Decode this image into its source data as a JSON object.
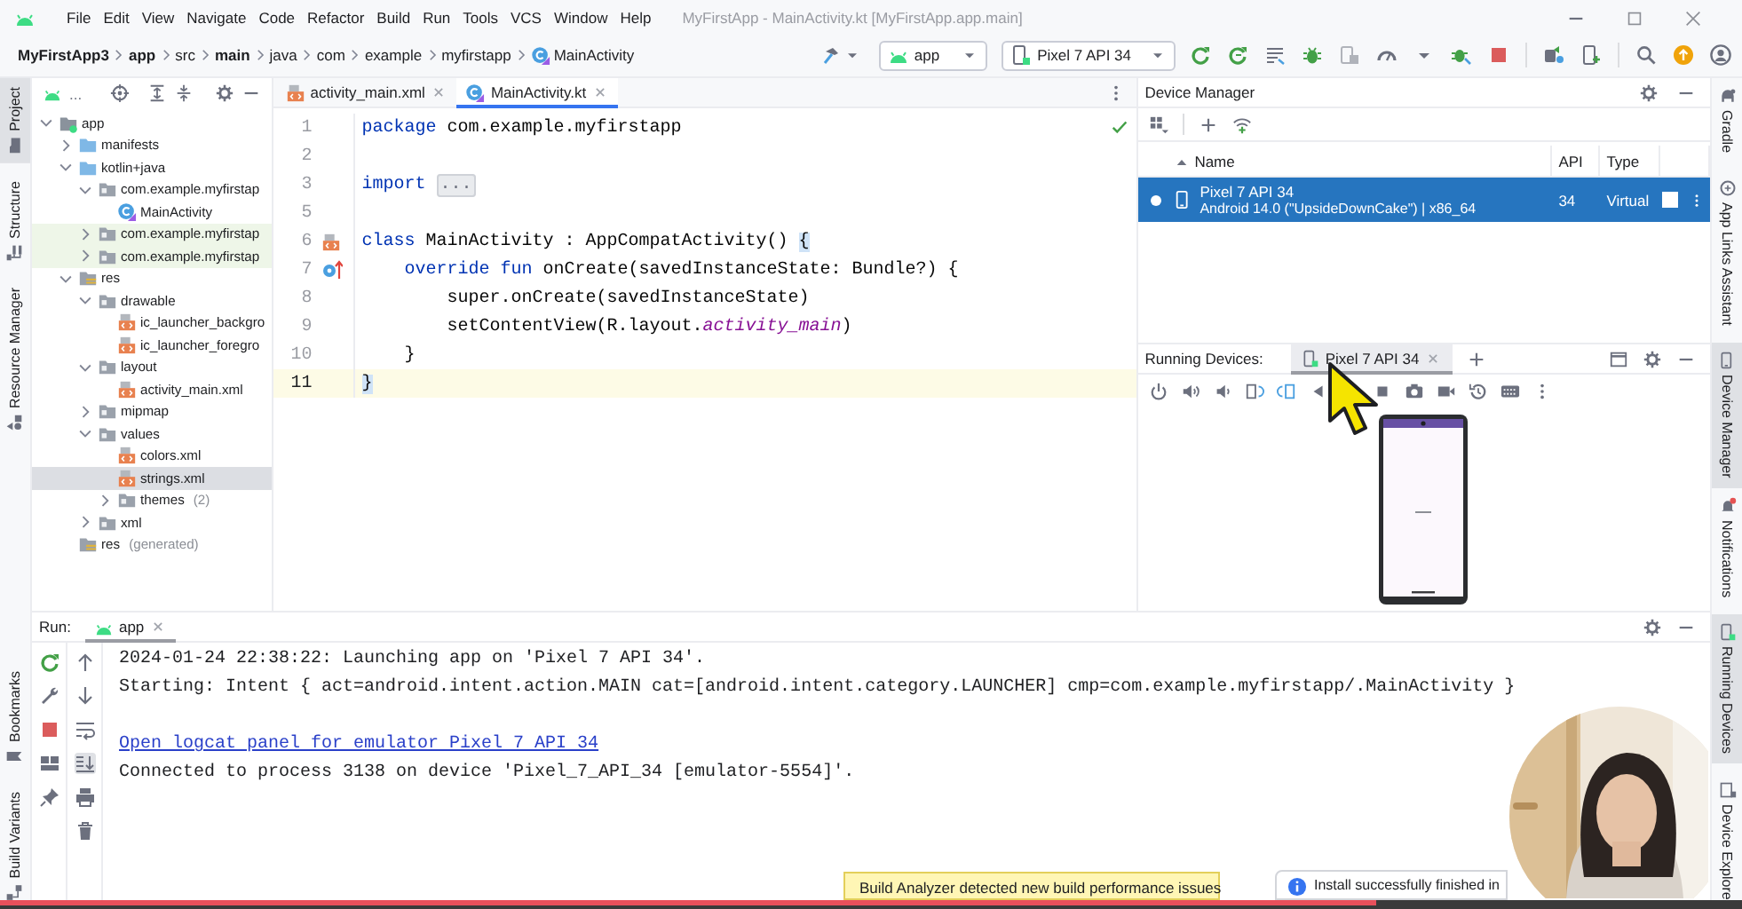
{
  "window": {
    "title": "MyFirstApp - MainActivity.kt [MyFirstApp.app.main]"
  },
  "menu": [
    "File",
    "Edit",
    "View",
    "Navigate",
    "Code",
    "Refactor",
    "Build",
    "Run",
    "Tools",
    "VCS",
    "Window",
    "Help"
  ],
  "breadcrumb": [
    {
      "label": "MyFirstApp3",
      "bold": true,
      "kind": "path"
    },
    {
      "label": "app",
      "bold": true,
      "kind": "path"
    },
    {
      "label": "src",
      "bold": false,
      "kind": "path"
    },
    {
      "label": "main",
      "bold": true,
      "kind": "path"
    },
    {
      "label": "java",
      "bold": false,
      "kind": "path"
    },
    {
      "label": "com",
      "bold": false,
      "kind": "path"
    },
    {
      "label": "example",
      "bold": false,
      "kind": "path"
    },
    {
      "label": "myfirstapp",
      "bold": false,
      "kind": "path"
    },
    {
      "label": "MainActivity",
      "bold": false,
      "kind": "class"
    }
  ],
  "toolbar": {
    "run_config": "app",
    "device": "Pixel 7 API 34"
  },
  "left_stripe": {
    "top": [
      {
        "label": "Project",
        "kind": "project",
        "selected": true
      },
      {
        "label": "Structure",
        "kind": "structure",
        "selected": false
      },
      {
        "label": "Resource Manager",
        "kind": "resources",
        "selected": false
      }
    ],
    "bottom": [
      {
        "label": "Bookmarks",
        "kind": "bookmarks",
        "selected": false
      },
      {
        "label": "Build Variants",
        "kind": "variants",
        "selected": false
      }
    ]
  },
  "right_stripe": {
    "top": [
      {
        "label": "Gradle",
        "kind": "gradle",
        "selected": false
      },
      {
        "label": "App Links Assistant",
        "kind": "links",
        "selected": false
      },
      {
        "label": "Device Manager",
        "kind": "devices",
        "selected": true
      }
    ],
    "bottom": [
      {
        "label": "Notifications",
        "kind": "notifications",
        "selected": false
      },
      {
        "label": "Running Devices",
        "kind": "running",
        "selected": true
      },
      {
        "label": "Device Explore",
        "kind": "explorer",
        "selected": false
      }
    ]
  },
  "project": {
    "view_label": "...",
    "tree": [
      {
        "label": "app",
        "kind": "module",
        "expanded": true,
        "selected": false,
        "children": [
          {
            "label": "manifests",
            "kind": "source-folder",
            "expanded": false,
            "selected": false
          },
          {
            "label": "kotlin+java",
            "kind": "source-folder",
            "expanded": true,
            "selected": false,
            "children": [
              {
                "label": "com.example.myfirstap",
                "kind": "package",
                "expanded": true,
                "selected": false,
                "children": [
                  {
                    "label": "MainActivity",
                    "kind": "class",
                    "selected": false
                  }
                ]
              },
              {
                "label": "com.example.myfirstap",
                "kind": "test-package",
                "expanded": false,
                "selected": false
              },
              {
                "label": "com.example.myfirstap",
                "kind": "test-package",
                "expanded": false,
                "selected": false
              }
            ]
          },
          {
            "label": "res",
            "kind": "res-folder",
            "expanded": true,
            "selected": false,
            "children": [
              {
                "label": "drawable",
                "kind": "package",
                "expanded": true,
                "selected": false,
                "children": [
                  {
                    "label": "ic_launcher_backgro",
                    "kind": "xml",
                    "selected": false
                  },
                  {
                    "label": "ic_launcher_foregro",
                    "kind": "xml",
                    "selected": false
                  }
                ]
              },
              {
                "label": "layout",
                "kind": "package",
                "expanded": true,
                "selected": false,
                "children": [
                  {
                    "label": "activity_main.xml",
                    "kind": "xml",
                    "selected": false
                  }
                ]
              },
              {
                "label": "mipmap",
                "kind": "package",
                "expanded": false,
                "selected": false
              },
              {
                "label": "values",
                "kind": "package",
                "expanded": true,
                "selected": false,
                "children": [
                  {
                    "label": "colors.xml",
                    "kind": "xml",
                    "selected": false
                  },
                  {
                    "label": "strings.xml",
                    "kind": "xml",
                    "selected": true
                  },
                  {
                    "label": "themes",
                    "count": "(2)",
                    "kind": "package",
                    "expanded": false,
                    "selected": false
                  }
                ]
              },
              {
                "label": "xml",
                "kind": "package",
                "expanded": false,
                "selected": false
              }
            ]
          },
          {
            "label": "res",
            "count": "(generated)",
            "kind": "res-folder",
            "selected": false
          }
        ]
      }
    ]
  },
  "editor": {
    "tabs": [
      {
        "label": "activity_main.xml",
        "kind": "xml",
        "selected": false
      },
      {
        "label": "MainActivity.kt",
        "kind": "class",
        "selected": true
      }
    ],
    "lines": [
      {
        "number": "1",
        "current": false,
        "tokens": [
          {
            "kind": "keyword",
            "text": "package"
          },
          {
            "kind": "plain",
            "text": " com.example.myfirstapp"
          }
        ]
      },
      {
        "number": "2",
        "current": false
      },
      {
        "number": "3",
        "current": false,
        "tokens": [
          {
            "kind": "keyword",
            "text": "import"
          },
          {
            "kind": "fold",
            "text": "..."
          }
        ]
      },
      {
        "number": "5",
        "current": false
      },
      {
        "number": "6",
        "current": false,
        "marker": {
          "kind": "layout"
        },
        "tokens": [
          {
            "kind": "keyword",
            "text": "class"
          },
          {
            "kind": "plain",
            "text": " MainActivity : AppCompatActivity() "
          },
          {
            "kind": "brace",
            "text": "{"
          }
        ]
      },
      {
        "number": "7",
        "current": false,
        "marker": {
          "kind": "override"
        },
        "tokens": [
          {
            "kind": "keyword",
            "text": "    override fun"
          },
          {
            "kind": "plain",
            "text": " onCreate(savedInstanceState: Bundle?) {"
          }
        ]
      },
      {
        "number": "8",
        "current": false,
        "tokens": [
          {
            "kind": "plain",
            "text": "        super.onCreate(savedInstanceState)"
          }
        ]
      },
      {
        "number": "9",
        "current": false,
        "tokens": [
          {
            "kind": "plain",
            "text": "        setContentView(R.layout."
          },
          {
            "kind": "ref",
            "text": "activity_main"
          },
          {
            "kind": "plain",
            "text": ")"
          }
        ]
      },
      {
        "number": "10",
        "current": false,
        "tokens": [
          {
            "kind": "plain",
            "text": "    }"
          }
        ]
      },
      {
        "number": "11",
        "current": true,
        "tokens": [
          {
            "kind": "brace",
            "text": "}"
          }
        ]
      }
    ]
  },
  "device_manager": {
    "title": "Device Manager",
    "columns": [
      "Name",
      "API",
      "Type"
    ],
    "devices": [
      {
        "name": "Pixel 7 API 34",
        "details": "Android 14.0 (\"UpsideDownCake\") | x86_64",
        "api": "34",
        "type": "Virtual",
        "selected": true,
        "online": true
      }
    ]
  },
  "running_devices": {
    "label": "Running Devices:",
    "tabs": [
      {
        "label": "Pixel 7 API 34",
        "selected": true
      }
    ]
  },
  "run_panel": {
    "label": "Run:",
    "tabs": [
      {
        "label": "app",
        "selected": true
      }
    ],
    "lines": [
      {
        "kind": "text",
        "text": "2024-01-24 22:38:22: Launching app on 'Pixel 7 API 34'."
      },
      {
        "kind": "text",
        "text": "Starting: Intent { act=android.intent.action.MAIN cat=[android.intent.category.LAUNCHER] cmp=com.example.myfirstapp/.MainActivity }"
      },
      {
        "kind": "blank"
      },
      {
        "kind": "link",
        "text": "Open logcat panel for emulator Pixel 7 API 34"
      },
      {
        "kind": "text",
        "text": "Connected to process 3138 on device 'Pixel_7_API_34 [emulator-5554]'."
      }
    ]
  },
  "notifications": [
    {
      "kind": "warning",
      "text": "Build Analyzer detected new build performance issues"
    },
    {
      "kind": "info",
      "text": "Install successfully finished in"
    }
  ],
  "video_progress": {
    "level": 0.79
  }
}
